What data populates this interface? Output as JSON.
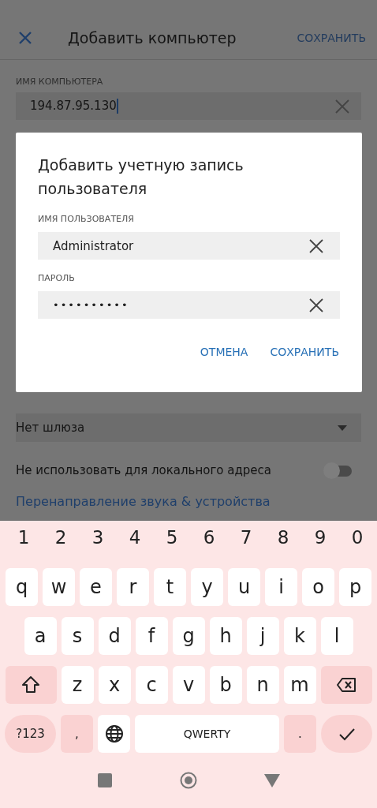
{
  "app_bar": {
    "title": "Добавить компьютер",
    "action": "СОХРАНИТЬ"
  },
  "computer_field": {
    "label": "ИМЯ КОМПЬЮТЕРА",
    "value": "194.87.95.130"
  },
  "gateway": {
    "value": "Нет шлюза"
  },
  "local_toggle": {
    "label": "Не использовать для локального адреса",
    "on": false
  },
  "link": "Перенаправление звука & устройства",
  "dialog": {
    "title": "Добавить учетную запись пользователя",
    "fields": [
      {
        "label": "ИМЯ ПОЛЬЗОВАТЕЛЯ",
        "value": "Administrator",
        "kind": "text"
      },
      {
        "label": "ПАРОЛЬ",
        "value": "••••••••••",
        "kind": "password"
      }
    ],
    "buttons": [
      "ОТМЕНА",
      "СОХРАНИТЬ"
    ]
  },
  "keyboard": {
    "number_row": [
      "1",
      "2",
      "3",
      "4",
      "5",
      "6",
      "7",
      "8",
      "9",
      "0"
    ],
    "top_row": [
      {
        "kind": "letter",
        "label": "q"
      },
      {
        "kind": "letter",
        "label": "w"
      },
      {
        "kind": "letter",
        "label": "e"
      },
      {
        "kind": "letter",
        "label": "r"
      },
      {
        "kind": "letter",
        "label": "t"
      },
      {
        "kind": "letter",
        "label": "y"
      },
      {
        "kind": "letter",
        "label": "u"
      },
      {
        "kind": "letter",
        "label": "i"
      },
      {
        "kind": "letter",
        "label": "o"
      },
      {
        "kind": "letter",
        "label": "p"
      }
    ],
    "home_row": [
      {
        "kind": "letter",
        "label": "a"
      },
      {
        "kind": "letter",
        "label": "s"
      },
      {
        "kind": "letter",
        "label": "d"
      },
      {
        "kind": "letter",
        "label": "f"
      },
      {
        "kind": "letter",
        "label": "g"
      },
      {
        "kind": "letter",
        "label": "h"
      },
      {
        "kind": "letter",
        "label": "j"
      },
      {
        "kind": "letter",
        "label": "k"
      },
      {
        "kind": "letter",
        "label": "l"
      }
    ],
    "bottom_letter_row": [
      {
        "kind": "shift"
      },
      {
        "kind": "letter",
        "label": "z"
      },
      {
        "kind": "letter",
        "label": "x"
      },
      {
        "kind": "letter",
        "label": "c"
      },
      {
        "kind": "letter",
        "label": "v"
      },
      {
        "kind": "letter",
        "label": "b"
      },
      {
        "kind": "letter",
        "label": "n"
      },
      {
        "kind": "letter",
        "label": "m"
      },
      {
        "kind": "backspace"
      }
    ],
    "function_row": [
      {
        "kind": "symbols",
        "label": "?123"
      },
      {
        "kind": "punct",
        "label": ","
      },
      {
        "kind": "globe"
      },
      {
        "kind": "space",
        "label": "QWERTY"
      },
      {
        "kind": "punct",
        "label": "."
      },
      {
        "kind": "enter"
      }
    ]
  }
}
